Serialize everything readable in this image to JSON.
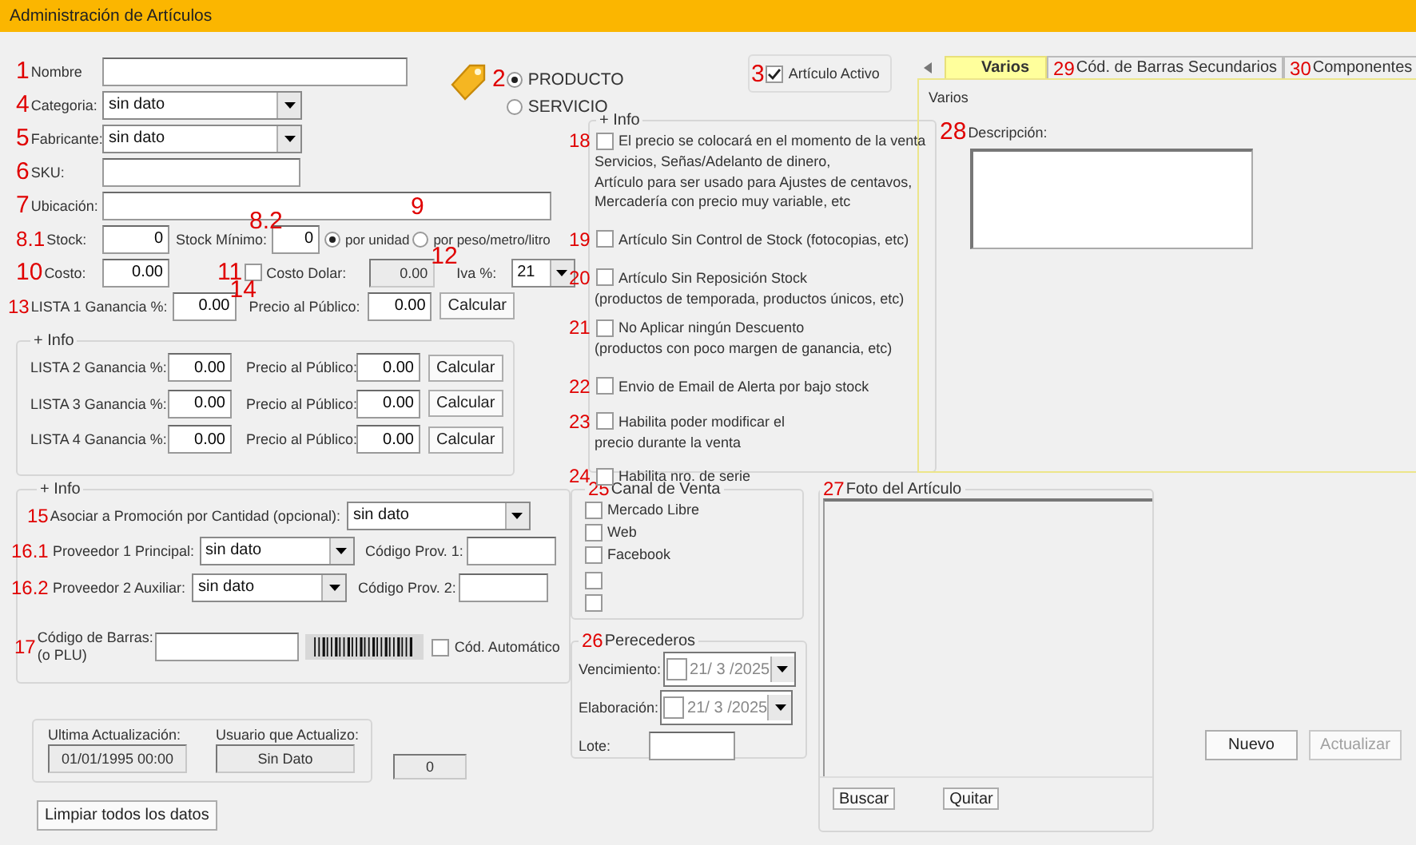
{
  "window": {
    "title": "Administración de Artículos"
  },
  "nombre": {
    "marker": "1",
    "label": "Nombre"
  },
  "tipo": {
    "marker": "2",
    "options": [
      {
        "label": "PRODUCTO",
        "selected": true
      },
      {
        "label": "SERVICIO",
        "selected": false
      }
    ]
  },
  "activo": {
    "marker": "3",
    "label": "Artículo Activo",
    "checked": true
  },
  "categoria": {
    "marker": "4",
    "label": "Categoria:",
    "value": "sin dato"
  },
  "fabricante": {
    "marker": "5",
    "label": "Fabricante:",
    "value": "sin dato"
  },
  "sku": {
    "marker": "6",
    "label": "SKU:"
  },
  "ubicacion": {
    "marker": "7",
    "label": "Ubicación:"
  },
  "stock": {
    "marker": "8.1",
    "label": "Stock:",
    "value": "0"
  },
  "stock_minimo": {
    "marker": "8.2",
    "label": "Stock Mínimo:",
    "value": "0"
  },
  "unidad": {
    "marker": "9",
    "options": [
      {
        "label": "por unidad",
        "selected": true
      },
      {
        "label": "por peso/metro/litro",
        "selected": false
      }
    ]
  },
  "costo": {
    "marker": "10",
    "label": "Costo:",
    "value": "0.00"
  },
  "costo_dolar": {
    "marker": "11",
    "label": "Costo Dolar:",
    "checked": false,
    "value": "0.00"
  },
  "iva": {
    "marker": "12",
    "label": "Iva %:",
    "value": "21"
  },
  "lista1": {
    "marker": "13",
    "label": "LISTA 1 Ganancia %:",
    "value": "0.00",
    "price_marker": "14",
    "price_label": "Precio al Público:",
    "price": "0.00",
    "button": "Calcular"
  },
  "listas_group": {
    "title": "+ Info",
    "rows": [
      {
        "label": "LISTA 2 Ganancia %:",
        "value": "0.00",
        "price_label": "Precio al Público:",
        "price": "0.00",
        "button": "Calcular"
      },
      {
        "label": "LISTA 3 Ganancia %:",
        "value": "0.00",
        "price_label": "Precio al Público:",
        "price": "0.00",
        "button": "Calcular"
      },
      {
        "label": "LISTA 4 Ganancia %:",
        "value": "0.00",
        "price_label": "Precio al Público:",
        "price": "0.00",
        "button": "Calcular"
      }
    ]
  },
  "proveedores_group": {
    "title": "+ Info",
    "promo": {
      "marker": "15",
      "label": "Asociar a Promoción por Cantidad (opcional):",
      "value": "sin dato"
    },
    "providers": [
      {
        "marker": "16.1",
        "label": "Proveedor 1 Principal:",
        "value": "sin dato",
        "code_label": "Código Prov. 1:"
      },
      {
        "marker": "16.2",
        "label": "Proveedor 2 Auxiliar:",
        "value": "sin dato",
        "code_label": "Código Prov. 2:"
      }
    ],
    "barcode": {
      "marker": "17",
      "label": "Código de Barras:",
      "sublabel": "(o PLU)",
      "auto_label": "Cód. Automático",
      "auto_checked": false
    }
  },
  "audit": {
    "fields": [
      {
        "label": "Ultima Actualización:",
        "value": "01/01/1995 00:00"
      },
      {
        "label": "Usuario que Actualizo:",
        "value": "Sin Dato"
      }
    ],
    "counter": "0"
  },
  "clear_button": "Limpiar todos los datos",
  "options_group": {
    "title": "+ Info",
    "items": [
      {
        "marker": "18",
        "label": "El precio se colocará en el momento de la venta",
        "notes": [
          "Servicios, Señas/Adelanto de dinero,",
          "Artículo para ser usado para Ajustes de centavos,",
          "Mercadería con precio muy variable, etc"
        ],
        "checked": false
      },
      {
        "marker": "19",
        "label": "Artículo Sin Control de Stock (fotocopias, etc)",
        "checked": false
      },
      {
        "marker": "20",
        "label": "Artículo Sin Reposición Stock",
        "notes": [
          "(productos de temporada, productos únicos, etc)"
        ],
        "checked": false
      },
      {
        "marker": "21",
        "label": "No Aplicar ningún Descuento",
        "notes": [
          "(productos con poco margen de ganancia, etc)"
        ],
        "checked": false
      },
      {
        "marker": "22",
        "label": "Envio de Email de Alerta por bajo stock",
        "checked": false
      },
      {
        "marker": "23",
        "label": "Habilita poder modificar el",
        "notes": [
          "precio durante la venta"
        ],
        "checked": false
      },
      {
        "marker": "24",
        "label": "Habilita nro. de serie",
        "checked": false
      }
    ]
  },
  "canal_venta": {
    "marker": "25",
    "title": "Canal de Venta",
    "items": [
      {
        "label": "Mercado Libre",
        "checked": false
      },
      {
        "label": "Web",
        "checked": false
      },
      {
        "label": "Facebook",
        "checked": false
      },
      {
        "checked": false
      },
      {
        "checked": false
      }
    ]
  },
  "perecederos": {
    "marker": "26",
    "title": "Perecederos",
    "dates": [
      {
        "label": "Vencimiento:",
        "value": "21/ 3 /2025",
        "checked": false
      },
      {
        "label": "Elaboración:",
        "value": "21/ 3 /2025",
        "checked": false
      }
    ],
    "lote_label": "Lote:"
  },
  "foto": {
    "marker": "27",
    "title": "Foto del Artículo",
    "buttons": [
      "Buscar",
      "Quitar"
    ]
  },
  "tabs": [
    {
      "label": "Varios",
      "selected": true
    },
    {
      "marker": "29",
      "label": "Cód. de Barras Secundarios",
      "selected": false
    },
    {
      "marker": "30",
      "label": "Componentes",
      "selected": false
    }
  ],
  "tab_panel": {
    "title": "Varios",
    "descripcion": {
      "marker": "28",
      "label": "Descripción:"
    }
  },
  "actions": [
    {
      "label": "Nuevo",
      "disabled": false
    },
    {
      "label": "Actualizar",
      "disabled": true
    }
  ]
}
